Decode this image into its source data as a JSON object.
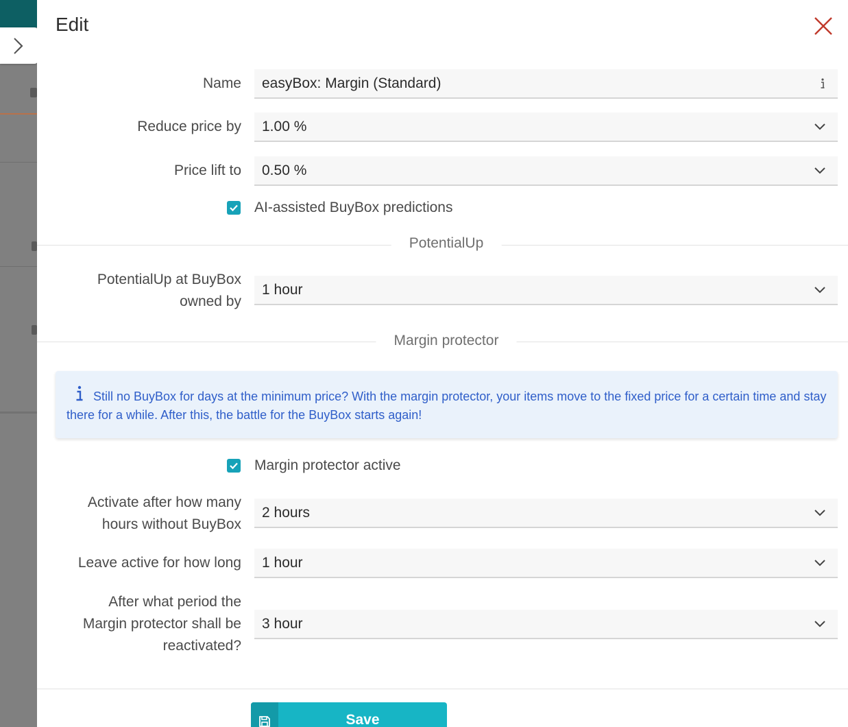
{
  "drawer": {
    "title": "Edit",
    "close_icon": "close-x-icon",
    "close_color": "#c0392b"
  },
  "form": {
    "name": {
      "label": "Name",
      "value": "easyBox: Margin (Standard)",
      "icon": "info-i-icon"
    },
    "reduce_price": {
      "label": "Reduce price by",
      "value": "1.00 %"
    },
    "price_lift": {
      "label": "Price lift to",
      "value": "0.50 %"
    },
    "ai_predictions": {
      "label": "AI-assisted BuyBox predictions",
      "checked": true
    }
  },
  "sections": {
    "potentialup": {
      "title": "PotentialUp",
      "buybox_owned": {
        "label_line1": "PotentialUp at BuyBox",
        "label_line2": "owned by",
        "value": "1 hour"
      }
    },
    "margin_protector": {
      "title": "Margin protector",
      "info_text": "Still no BuyBox for days at the minimum price? With the margin protector, your items move to the fixed price for a certain time and stay there for a while. After this, the battle for the BuyBox starts again!",
      "active": {
        "label": "Margin protector active",
        "checked": true
      },
      "activate_after": {
        "label_line1": "Activate after how many",
        "label_line2": "hours without BuyBox",
        "value": "2 hours"
      },
      "leave_active": {
        "label": "Leave active for how long",
        "value": "1 hour"
      },
      "reactivate": {
        "label_line1": "After what period the",
        "label_line2": "Margin protector shall be",
        "label_line3": "reactivated?",
        "value": "3 hour"
      }
    }
  },
  "footer": {
    "save_label": "Save",
    "save_icon": "floppy-disk-icon"
  },
  "colors": {
    "accent": "#17a2b8",
    "save": "#17b5c5",
    "info_text": "#2f5ec9",
    "info_bg": "#eaf2fb",
    "sidebar_teal": "#0d5f63"
  }
}
